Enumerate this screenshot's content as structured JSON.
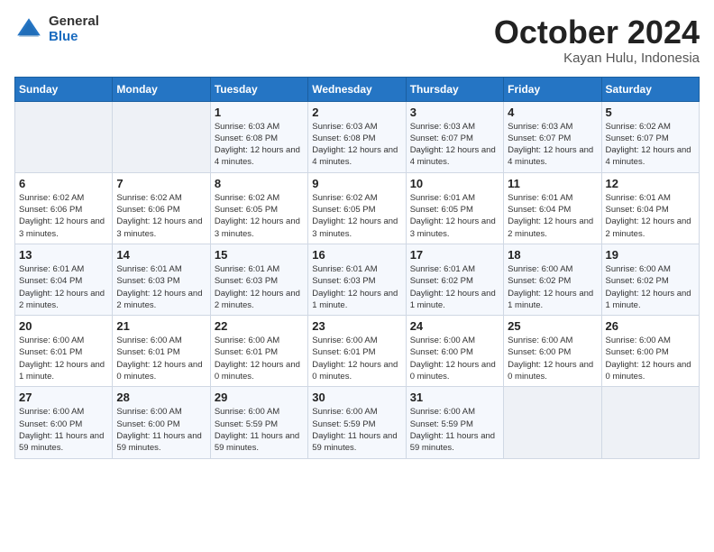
{
  "logo": {
    "general": "General",
    "blue": "Blue"
  },
  "title": "October 2024",
  "subtitle": "Kayan Hulu, Indonesia",
  "days_of_week": [
    "Sunday",
    "Monday",
    "Tuesday",
    "Wednesday",
    "Thursday",
    "Friday",
    "Saturday"
  ],
  "weeks": [
    [
      {
        "day": "",
        "info": ""
      },
      {
        "day": "",
        "info": ""
      },
      {
        "day": "1",
        "info": "Sunrise: 6:03 AM\nSunset: 6:08 PM\nDaylight: 12 hours and 4 minutes."
      },
      {
        "day": "2",
        "info": "Sunrise: 6:03 AM\nSunset: 6:08 PM\nDaylight: 12 hours and 4 minutes."
      },
      {
        "day": "3",
        "info": "Sunrise: 6:03 AM\nSunset: 6:07 PM\nDaylight: 12 hours and 4 minutes."
      },
      {
        "day": "4",
        "info": "Sunrise: 6:03 AM\nSunset: 6:07 PM\nDaylight: 12 hours and 4 minutes."
      },
      {
        "day": "5",
        "info": "Sunrise: 6:02 AM\nSunset: 6:07 PM\nDaylight: 12 hours and 4 minutes."
      }
    ],
    [
      {
        "day": "6",
        "info": "Sunrise: 6:02 AM\nSunset: 6:06 PM\nDaylight: 12 hours and 3 minutes."
      },
      {
        "day": "7",
        "info": "Sunrise: 6:02 AM\nSunset: 6:06 PM\nDaylight: 12 hours and 3 minutes."
      },
      {
        "day": "8",
        "info": "Sunrise: 6:02 AM\nSunset: 6:05 PM\nDaylight: 12 hours and 3 minutes."
      },
      {
        "day": "9",
        "info": "Sunrise: 6:02 AM\nSunset: 6:05 PM\nDaylight: 12 hours and 3 minutes."
      },
      {
        "day": "10",
        "info": "Sunrise: 6:01 AM\nSunset: 6:05 PM\nDaylight: 12 hours and 3 minutes."
      },
      {
        "day": "11",
        "info": "Sunrise: 6:01 AM\nSunset: 6:04 PM\nDaylight: 12 hours and 2 minutes."
      },
      {
        "day": "12",
        "info": "Sunrise: 6:01 AM\nSunset: 6:04 PM\nDaylight: 12 hours and 2 minutes."
      }
    ],
    [
      {
        "day": "13",
        "info": "Sunrise: 6:01 AM\nSunset: 6:04 PM\nDaylight: 12 hours and 2 minutes."
      },
      {
        "day": "14",
        "info": "Sunrise: 6:01 AM\nSunset: 6:03 PM\nDaylight: 12 hours and 2 minutes."
      },
      {
        "day": "15",
        "info": "Sunrise: 6:01 AM\nSunset: 6:03 PM\nDaylight: 12 hours and 2 minutes."
      },
      {
        "day": "16",
        "info": "Sunrise: 6:01 AM\nSunset: 6:03 PM\nDaylight: 12 hours and 1 minute."
      },
      {
        "day": "17",
        "info": "Sunrise: 6:01 AM\nSunset: 6:02 PM\nDaylight: 12 hours and 1 minute."
      },
      {
        "day": "18",
        "info": "Sunrise: 6:00 AM\nSunset: 6:02 PM\nDaylight: 12 hours and 1 minute."
      },
      {
        "day": "19",
        "info": "Sunrise: 6:00 AM\nSunset: 6:02 PM\nDaylight: 12 hours and 1 minute."
      }
    ],
    [
      {
        "day": "20",
        "info": "Sunrise: 6:00 AM\nSunset: 6:01 PM\nDaylight: 12 hours and 1 minute."
      },
      {
        "day": "21",
        "info": "Sunrise: 6:00 AM\nSunset: 6:01 PM\nDaylight: 12 hours and 0 minutes."
      },
      {
        "day": "22",
        "info": "Sunrise: 6:00 AM\nSunset: 6:01 PM\nDaylight: 12 hours and 0 minutes."
      },
      {
        "day": "23",
        "info": "Sunrise: 6:00 AM\nSunset: 6:01 PM\nDaylight: 12 hours and 0 minutes."
      },
      {
        "day": "24",
        "info": "Sunrise: 6:00 AM\nSunset: 6:00 PM\nDaylight: 12 hours and 0 minutes."
      },
      {
        "day": "25",
        "info": "Sunrise: 6:00 AM\nSunset: 6:00 PM\nDaylight: 12 hours and 0 minutes."
      },
      {
        "day": "26",
        "info": "Sunrise: 6:00 AM\nSunset: 6:00 PM\nDaylight: 12 hours and 0 minutes."
      }
    ],
    [
      {
        "day": "27",
        "info": "Sunrise: 6:00 AM\nSunset: 6:00 PM\nDaylight: 11 hours and 59 minutes."
      },
      {
        "day": "28",
        "info": "Sunrise: 6:00 AM\nSunset: 6:00 PM\nDaylight: 11 hours and 59 minutes."
      },
      {
        "day": "29",
        "info": "Sunrise: 6:00 AM\nSunset: 5:59 PM\nDaylight: 11 hours and 59 minutes."
      },
      {
        "day": "30",
        "info": "Sunrise: 6:00 AM\nSunset: 5:59 PM\nDaylight: 11 hours and 59 minutes."
      },
      {
        "day": "31",
        "info": "Sunrise: 6:00 AM\nSunset: 5:59 PM\nDaylight: 11 hours and 59 minutes."
      },
      {
        "day": "",
        "info": ""
      },
      {
        "day": "",
        "info": ""
      }
    ]
  ]
}
